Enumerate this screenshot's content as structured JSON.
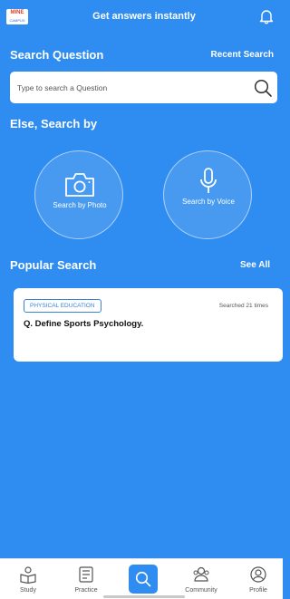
{
  "logo": {
    "top_text": "MINE",
    "bottom_text": "CAMPUS"
  },
  "header": {
    "title": "Get answers instantly",
    "bell_icon": "bell-icon"
  },
  "search": {
    "section_title": "Search Question",
    "recent_link": "Recent Search",
    "placeholder": "Type to search a Question",
    "icon": "search-icon"
  },
  "else_search": {
    "section_title": "Else, Search by",
    "photo_label": "Search by Photo",
    "photo_icon": "camera-icon",
    "voice_label": "Search by Voice",
    "voice_icon": "microphone-icon"
  },
  "popular": {
    "section_title": "Popular Search",
    "see_all": "See All",
    "cards": [
      {
        "tag": "PHYSICAL EDUCATION",
        "searched": "Searched 21 times",
        "question": "Q. Define Sports Psychology."
      }
    ]
  },
  "bottom_nav": {
    "items": [
      {
        "label": "Study",
        "icon": "study-icon"
      },
      {
        "label": "Practice",
        "icon": "practice-icon"
      },
      {
        "label": "",
        "icon": "search-icon"
      },
      {
        "label": "Community",
        "icon": "community-icon"
      },
      {
        "label": "Profile",
        "icon": "profile-icon"
      }
    ]
  },
  "colors": {
    "background": "#2f8cf0",
    "accent": "#3b82d6",
    "card": "#ffffff"
  }
}
